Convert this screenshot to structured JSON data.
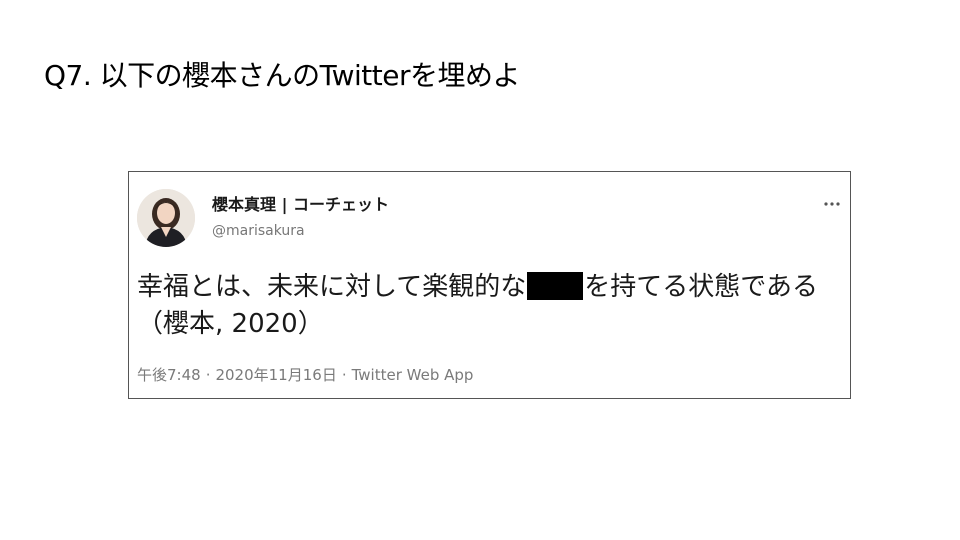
{
  "slide": {
    "title": "Q7. 以下の櫻本さんのTwitterを埋めよ"
  },
  "tweet": {
    "display_name": "櫻本真理 | コーチェット",
    "handle": "@marisakura",
    "text_before": "幸福とは、未来に対して楽観的な",
    "text_after": "を持てる状態である（櫻本, 2020）",
    "time": "午後7:48",
    "separator": "·",
    "date": "2020年11月16日",
    "source": "Twitter Web App",
    "more_icon": "more-horizontal-icon",
    "avatar_icon": "profile-photo"
  }
}
